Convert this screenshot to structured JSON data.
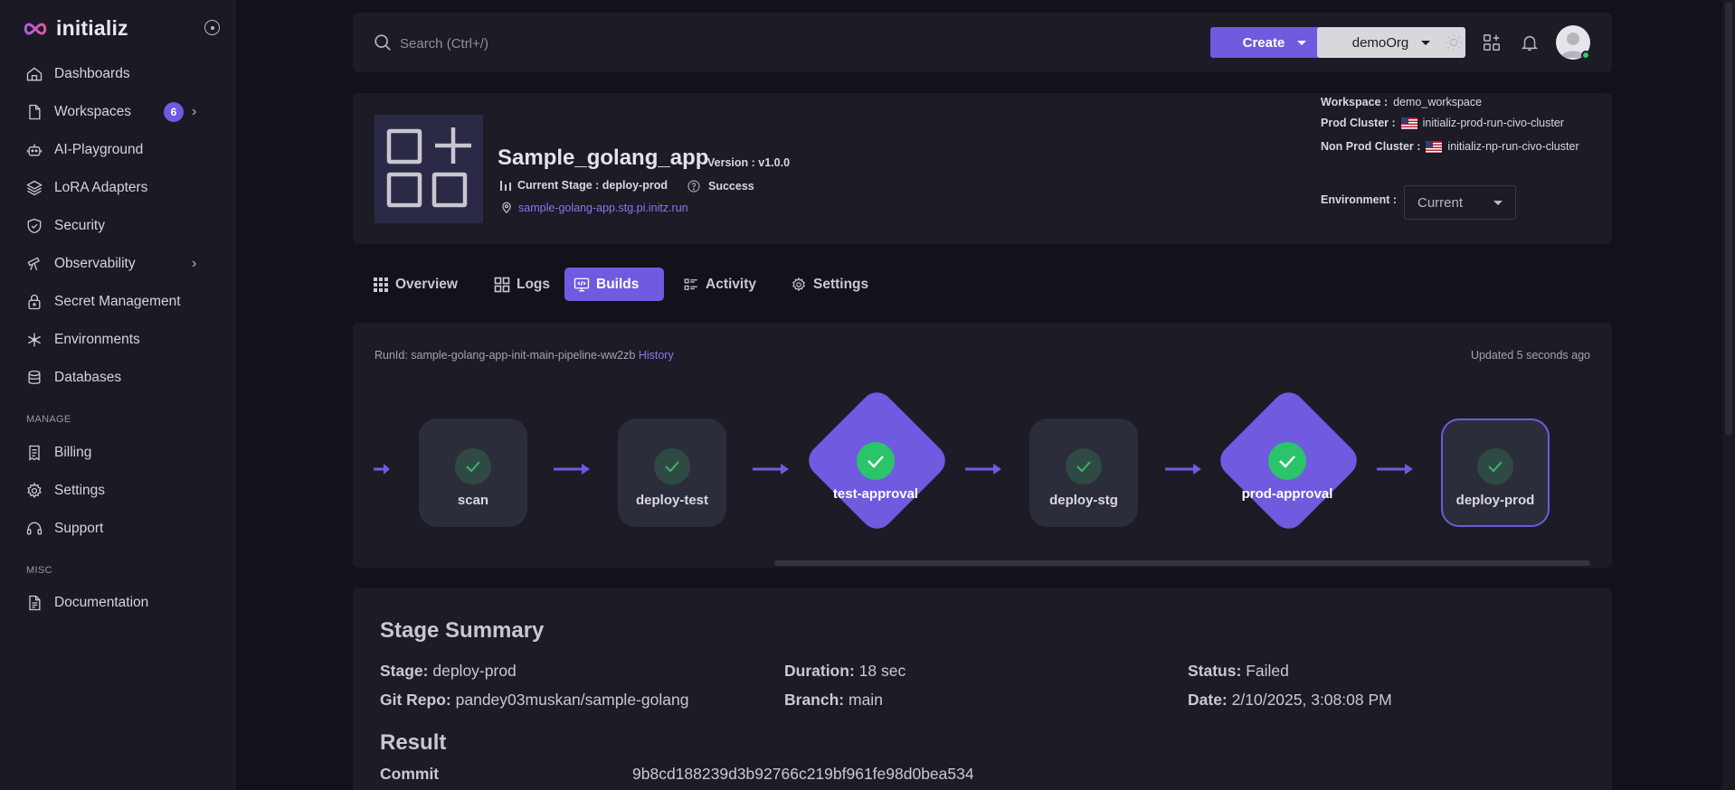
{
  "brand": {
    "name": "initializ"
  },
  "sidebar": {
    "items": [
      {
        "label": "Dashboards",
        "icon": "home-icon"
      },
      {
        "label": "Workspaces",
        "icon": "file-icon",
        "badge": "6"
      },
      {
        "label": "AI-Playground",
        "icon": "robot-icon"
      },
      {
        "label": "LoRA Adapters",
        "icon": "layers-icon"
      },
      {
        "label": "Security",
        "icon": "shield-check-icon"
      },
      {
        "label": "Observability",
        "icon": "telescope-icon"
      },
      {
        "label": "Secret Management",
        "icon": "lock-icon"
      },
      {
        "label": "Environments",
        "icon": "snowflake-icon"
      },
      {
        "label": "Databases",
        "icon": "database-icon"
      }
    ],
    "manage_label": "MANAGE",
    "manage_items": [
      {
        "label": "Billing",
        "icon": "receipt-icon"
      },
      {
        "label": "Settings",
        "icon": "gear-icon"
      },
      {
        "label": "Support",
        "icon": "headset-icon"
      }
    ],
    "misc_label": "MISC",
    "misc_items": [
      {
        "label": "Documentation",
        "icon": "document-icon"
      }
    ]
  },
  "header": {
    "search_placeholder": "Search (Ctrl+/)",
    "create_label": "Create",
    "org_label": "demoOrg"
  },
  "app": {
    "title": "Sample_golang_app",
    "version": "Version : v1.0.0",
    "current_stage": "Current Stage : deploy-prod",
    "status": "Success",
    "url": "sample-golang-app.stg.pi.initz.run",
    "workspace_label": "Workspace :",
    "workspace_value": "demo_workspace",
    "prod_cluster_label": "Prod Cluster :",
    "prod_cluster_value": "initializ-prod-run-civo-cluster",
    "nonprod_cluster_label": "Non Prod Cluster :",
    "nonprod_cluster_value": "initializ-np-run-civo-cluster",
    "environment_label": "Environment :",
    "environment_value": "Current"
  },
  "tabs": [
    {
      "label": "Overview",
      "icon": "grid-dots-icon"
    },
    {
      "label": "Logs",
      "icon": "grid-icon"
    },
    {
      "label": "Builds",
      "icon": "code-monitor-icon",
      "active": true
    },
    {
      "label": "Activity",
      "icon": "list-icon"
    },
    {
      "label": "Settings",
      "icon": "gear-icon"
    }
  ],
  "pipeline": {
    "runid_prefix": "RunId: sample-golang-app-init-main-pipeline-ww2zb",
    "history_label": "History",
    "updated": "Updated 5 seconds ago",
    "stages": [
      {
        "label": "scan",
        "kind": "box"
      },
      {
        "label": "deploy-test",
        "kind": "box"
      },
      {
        "label": "test-approval",
        "kind": "approval"
      },
      {
        "label": "deploy-stg",
        "kind": "box"
      },
      {
        "label": "prod-approval",
        "kind": "approval"
      },
      {
        "label": "deploy-prod",
        "kind": "box",
        "selected": true
      }
    ]
  },
  "summary": {
    "title": "Stage Summary",
    "stage_label": "Stage:",
    "stage_value": "deploy-prod",
    "duration_label": "Duration:",
    "duration_value": "18 sec",
    "status_label": "Status:",
    "status_value": "Failed",
    "repo_label": "Git Repo:",
    "repo_value": "pandey03muskan/sample-golang",
    "branch_label": "Branch:",
    "branch_value": "main",
    "date_label": "Date:",
    "date_value": "2/10/2025, 3:08:08 PM",
    "result_title": "Result",
    "commit_label": "Commit",
    "commit_value": "9b8cd188239d3b92766c219bf961fe98d0bea534"
  },
  "colors": {
    "accent": "#6f5ae0",
    "success": "#2bc46a",
    "background": "#13121a",
    "card": "#1c1b26"
  }
}
